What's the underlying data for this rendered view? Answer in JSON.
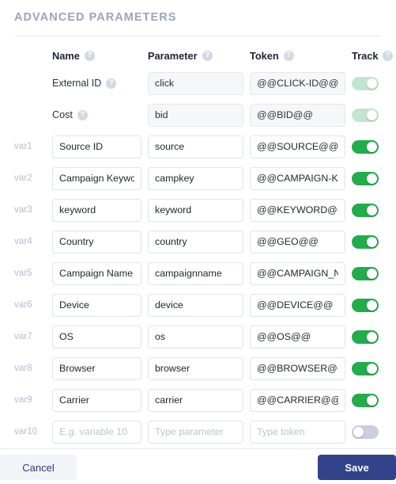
{
  "panel": {
    "title": "ADVANCED PARAMETERS"
  },
  "colors": {
    "title": "#9aa5b8",
    "toggle_on": "#22ac4b",
    "toggle_on_muted": "#c2e6cd",
    "toggle_off": "#c9d0dc",
    "save_button": "#32438c",
    "cancel_text": "#2d3a77"
  },
  "columns": {
    "var": "",
    "name": "Name",
    "parameter": "Parameter",
    "token": "Token",
    "track": "Track",
    "help_glyph": "?"
  },
  "placeholders": {
    "name": "E.g. variable 10",
    "parameter": "Type parameter",
    "token": "Type token"
  },
  "rows": [
    {
      "var": "",
      "name_label": "External ID",
      "name_has_help": true,
      "parameter": "click",
      "token": "@@CLICK-ID@@",
      "disabled": true,
      "track_on": true,
      "track_muted": true
    },
    {
      "var": "",
      "name_label": "Cost",
      "name_has_help": true,
      "parameter": "bid",
      "token": "@@BID@@",
      "disabled": true,
      "track_on": true,
      "track_muted": true
    },
    {
      "var": "var1",
      "name": "Source ID",
      "parameter": "source",
      "token": "@@SOURCE@@",
      "disabled": false,
      "track_on": true,
      "track_muted": false
    },
    {
      "var": "var2",
      "name": "Campaign Keyword",
      "parameter": "campkey",
      "token": "@@CAMPAIGN-KEYWORD@@",
      "disabled": false,
      "track_on": true,
      "track_muted": false
    },
    {
      "var": "var3",
      "name": "keyword",
      "parameter": "keyword",
      "token": "@@KEYWORD@@",
      "disabled": false,
      "track_on": true,
      "track_muted": false
    },
    {
      "var": "var4",
      "name": "Country",
      "parameter": "country",
      "token": "@@GEO@@",
      "disabled": false,
      "track_on": true,
      "track_muted": false
    },
    {
      "var": "var5",
      "name": "Campaign Name",
      "parameter": "campaignname",
      "token": "@@CAMPAIGN_NAME@@",
      "disabled": false,
      "track_on": true,
      "track_muted": false
    },
    {
      "var": "var6",
      "name": "Device",
      "parameter": "device",
      "token": "@@DEVICE@@",
      "disabled": false,
      "track_on": true,
      "track_muted": false
    },
    {
      "var": "var7",
      "name": "OS",
      "parameter": "os",
      "token": "@@OS@@",
      "disabled": false,
      "track_on": true,
      "track_muted": false
    },
    {
      "var": "var8",
      "name": "Browser",
      "parameter": "browser",
      "token": "@@BROWSER@@",
      "disabled": false,
      "track_on": true,
      "track_muted": false
    },
    {
      "var": "var9",
      "name": "Carrier",
      "parameter": "carrier",
      "token": "@@CARRIER@@",
      "disabled": false,
      "track_on": true,
      "track_muted": false
    },
    {
      "var": "var10",
      "name": "",
      "parameter": "",
      "token": "",
      "disabled": false,
      "track_on": false,
      "track_muted": false,
      "is_empty": true
    }
  ],
  "footer": {
    "cancel_label": "Cancel",
    "save_label": "Save"
  }
}
